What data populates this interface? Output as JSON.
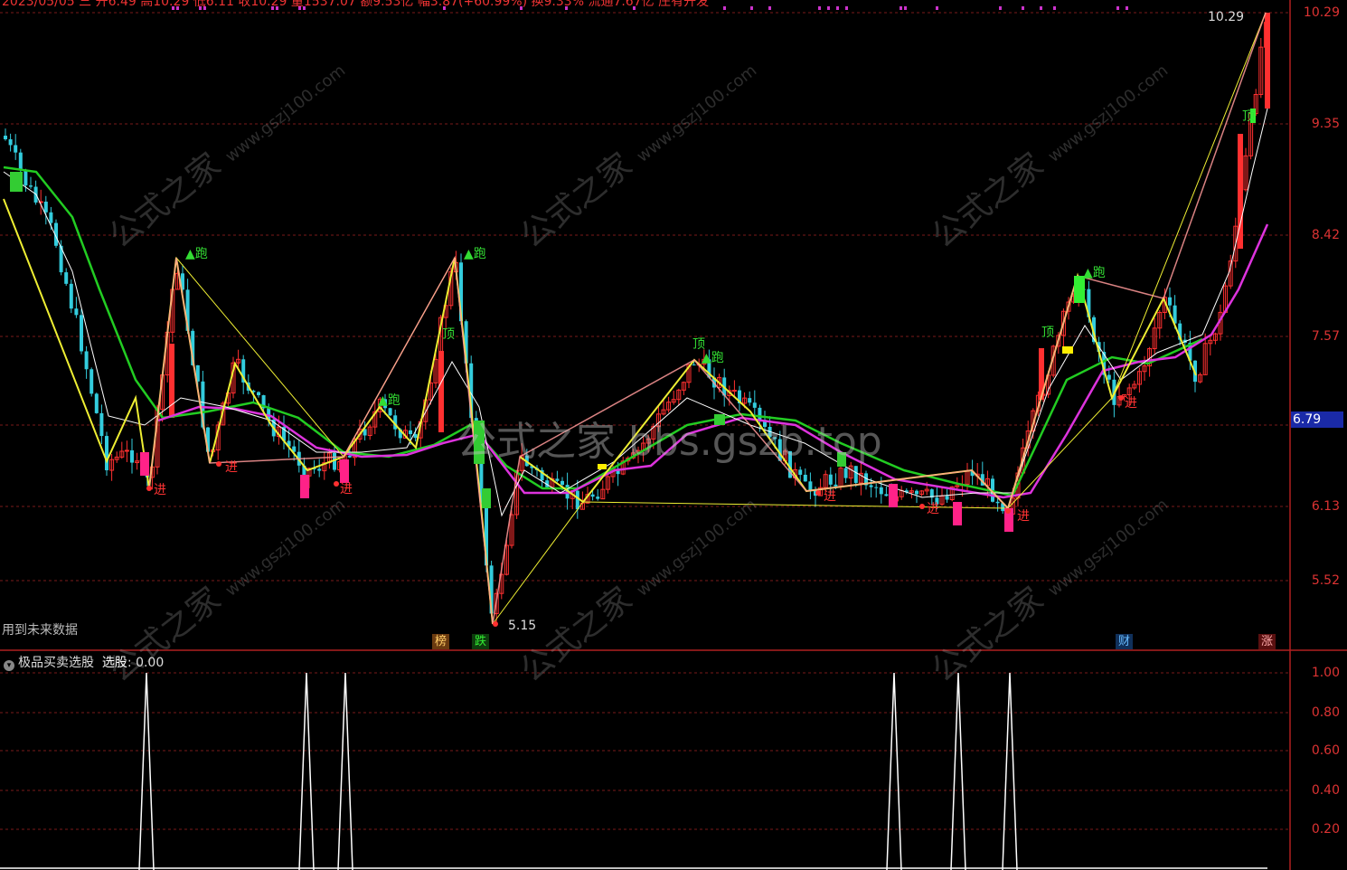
{
  "header": {
    "strip": "2023/05/05 三 开6.49 高10.29 低6.11 收10.29 量1537.07 额9.53亿 幅3.87(+60.99%) 换9.33% 流通7.67亿 庄有开发"
  },
  "price_axis": {
    "ticks": [
      "10.29",
      "9.35",
      "8.42",
      "7.57",
      "6.13",
      "5.52"
    ],
    "current": "6.79"
  },
  "annotations": {
    "high_value": "10.29",
    "low_value": "5.15",
    "run": "▲跑",
    "top": "顶",
    "enter": "进",
    "future_note": "用到未来数据"
  },
  "badges": {
    "bang": "榜",
    "die": "跌",
    "cai": "财",
    "zhang": "涨"
  },
  "watermark": {
    "text1": "公式之家",
    "text2": "www.gszj100.com",
    "center": "公式之家 bbs.gszb.top"
  },
  "indicator": {
    "title": "极品买卖选股",
    "key": "选股",
    "value": "0.00",
    "ticks": [
      "1.00",
      "0.80",
      "0.60",
      "0.40",
      "0.20"
    ],
    "spikes_x": [
      162,
      339,
      382,
      989,
      1060,
      1117
    ]
  },
  "colors": {
    "grid": "#7a1a1a",
    "up": "#ff3030",
    "down": "#33ccdd",
    "ma_green": "#22cc22",
    "ma_magenta": "#dd33dd",
    "zig_yellow": "#eeee33",
    "zig_pink": "#ff9999"
  }
}
